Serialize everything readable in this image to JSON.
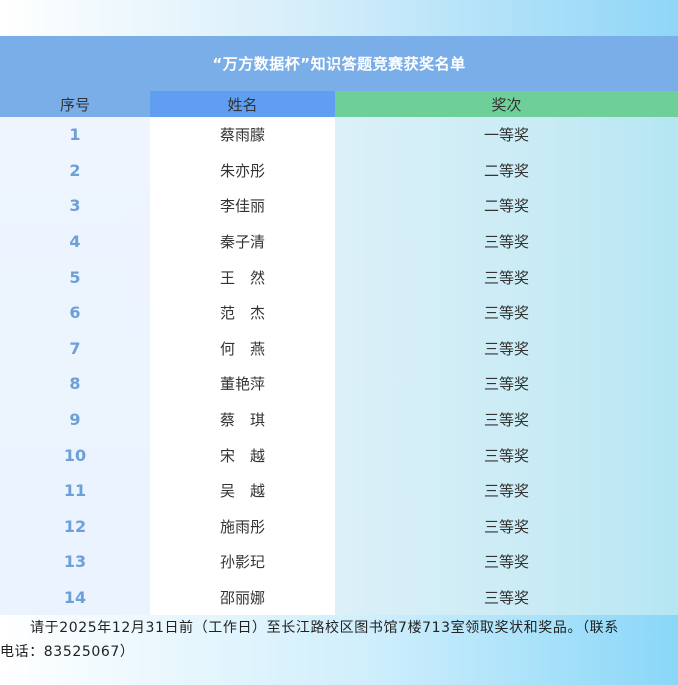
{
  "title": "“万方数据杯”知识答题竞赛获奖名单",
  "headers": {
    "number": "序号",
    "name": "姓名",
    "prize": "奖次"
  },
  "rows": [
    {
      "number": "1",
      "name": "蔡雨朦",
      "prize": "一等奖"
    },
    {
      "number": "2",
      "name": "朱亦彤",
      "prize": "二等奖"
    },
    {
      "number": "3",
      "name": "李佳丽",
      "prize": "二等奖"
    },
    {
      "number": "4",
      "name": "秦子清",
      "prize": "三等奖"
    },
    {
      "number": "5",
      "name": "王　然",
      "prize": "三等奖"
    },
    {
      "number": "6",
      "name": "范　杰",
      "prize": "三等奖"
    },
    {
      "number": "7",
      "name": "何　燕",
      "prize": "三等奖"
    },
    {
      "number": "8",
      "name": "董艳萍",
      "prize": "三等奖"
    },
    {
      "number": "9",
      "name": "蔡　琪",
      "prize": "三等奖"
    },
    {
      "number": "10",
      "name": "宋　越",
      "prize": "三等奖"
    },
    {
      "number": "11",
      "name": "吴　越",
      "prize": "三等奖"
    },
    {
      "number": "12",
      "name": "施雨彤",
      "prize": "三等奖"
    },
    {
      "number": "13",
      "name": "孙影玘",
      "prize": "三等奖"
    },
    {
      "number": "14",
      "name": "邵丽娜",
      "prize": "三等奖"
    }
  ],
  "notice": {
    "line1": "请于2025年12月31日前（工作日）至长江路校区图书馆7楼713室领取奖状和奖品。（联系",
    "line2": "电话：83525067）"
  },
  "colors": {
    "title_bg": "#7aaee8",
    "header_name_bg": "#5f9ef0",
    "header_prize_bg": "#6ecf99",
    "number_text": "#6ea0d8"
  }
}
